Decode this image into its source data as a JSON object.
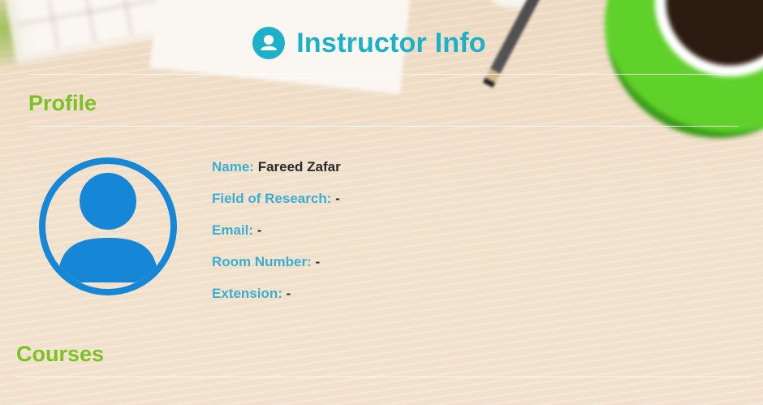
{
  "header": {
    "title": "Instructor Info",
    "icon": "user-circle-icon"
  },
  "profile": {
    "section_title": "Profile",
    "avatar_icon": "user-avatar-icon",
    "fields": [
      {
        "label": "Name:",
        "value": "Fareed Zafar"
      },
      {
        "label": "Field of Research:",
        "value": "-"
      },
      {
        "label": "Email:",
        "value": "-"
      },
      {
        "label": "Room Number:",
        "value": "-"
      },
      {
        "label": "Extension:",
        "value": "-"
      }
    ]
  },
  "courses": {
    "section_title": "Courses"
  },
  "colors": {
    "accent": "#1cb1c9",
    "section": "#7cc226",
    "label": "#3aaed0",
    "avatar": "#1587d6"
  }
}
